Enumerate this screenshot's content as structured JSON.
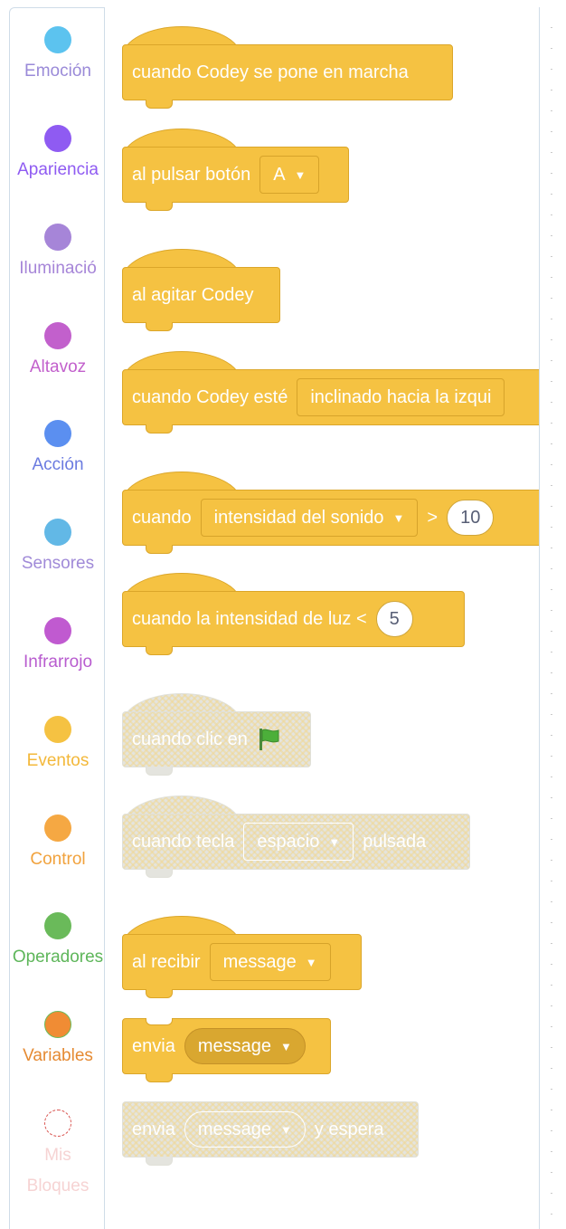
{
  "categories": [
    {
      "label": "Emoción",
      "color": "#5cc3ef",
      "text": "#9a8ad8"
    },
    {
      "label": "Apariencia",
      "color": "#8f5bf2",
      "text": "#8f5bf2"
    },
    {
      "label": "Iluminació",
      "color": "#a685d8",
      "text": "#a685d8"
    },
    {
      "label": "Altavoz",
      "color": "#c260cc",
      "text": "#c260cc"
    },
    {
      "label": "Acción",
      "color": "#5b8ff0",
      "text": "#6b7be0"
    },
    {
      "label": "Sensores",
      "color": "#62b8e6",
      "text": "#a08ad8"
    },
    {
      "label": "Infrarrojo",
      "color": "#c05ad0",
      "text": "#b85ccf"
    },
    {
      "label": "Eventos",
      "color": "#f5c242",
      "text": "#f3b83a"
    },
    {
      "label": "Control",
      "color": "#f5a843",
      "text": "#f1a23d"
    },
    {
      "label": "Operadores",
      "color": "#6aba5a",
      "text": "#5eb65a"
    },
    {
      "label": "Variables",
      "color": "#f08c34",
      "text": "#e58a32"
    },
    {
      "label": "Mis Bloques",
      "color": "#ffffff",
      "text": "#f6d3d3"
    }
  ],
  "blocks": {
    "b1": {
      "text": "cuando Codey se pone en marcha"
    },
    "b2": {
      "text": "al pulsar botón",
      "dropdown": "A"
    },
    "b3": {
      "text": "al agitar Codey"
    },
    "b4": {
      "text": "cuando Codey esté",
      "dropdown": "inclinado hacia la izqui"
    },
    "b5": {
      "text": "cuando",
      "dropdown": "intensidad del sonido",
      "op": ">",
      "value": "10"
    },
    "b6": {
      "text": "cuando la intensidad de luz <",
      "value": "5"
    },
    "b7": {
      "text": "cuando clic en"
    },
    "b8": {
      "text": "cuando tecla",
      "dropdown": "espacio",
      "suffix": "pulsada"
    },
    "b9": {
      "text": "al recibir",
      "dropdown": "message"
    },
    "b10": {
      "text": "envia",
      "reporter": "message"
    },
    "b11": {
      "text": "envia",
      "reporter": "message",
      "suffix": "y espera"
    }
  }
}
